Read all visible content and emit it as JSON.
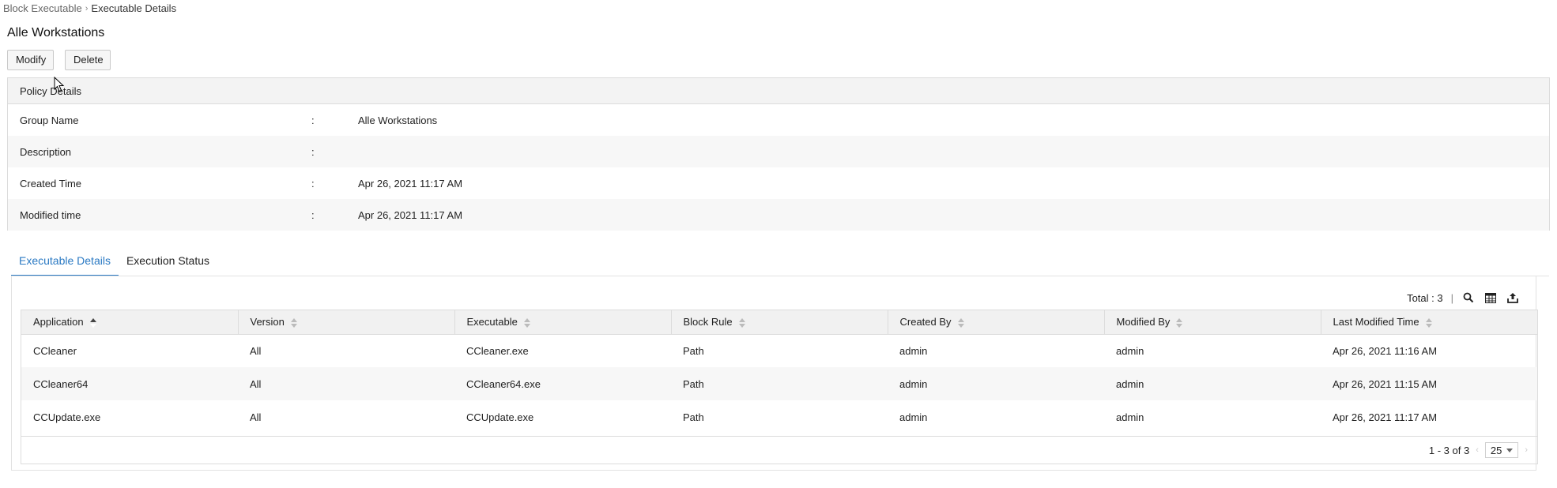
{
  "breadcrumb": {
    "parent": "Block Executable",
    "separator": "›",
    "current": "Executable Details"
  },
  "page": {
    "title": "Alle Workstations"
  },
  "actions": {
    "modify": "Modify",
    "delete": "Delete"
  },
  "policy": {
    "header": "Policy Details",
    "colon": ":",
    "rows": [
      {
        "label": "Group Name",
        "value": "Alle Workstations"
      },
      {
        "label": "Description",
        "value": ""
      },
      {
        "label": "Created Time",
        "value": "Apr 26, 2021 11:17 AM"
      },
      {
        "label": "Modified time",
        "value": "Apr 26, 2021 11:17 AM"
      }
    ]
  },
  "tabs": [
    {
      "label": "Executable Details",
      "active": true
    },
    {
      "label": "Execution Status",
      "active": false
    }
  ],
  "toolbar": {
    "total": "Total : 3",
    "divider": "|",
    "icons": [
      "search-icon",
      "columns-icon",
      "export-icon"
    ]
  },
  "table": {
    "columns": [
      "Application",
      "Version",
      "Executable",
      "Block Rule",
      "Created By",
      "Modified By",
      "Last Modified Time"
    ],
    "rows": [
      [
        "CCleaner",
        "All",
        "CCleaner.exe",
        "Path",
        "admin",
        "admin",
        "Apr 26, 2021 11:16 AM"
      ],
      [
        "CCleaner64",
        "All",
        "CCleaner64.exe",
        "Path",
        "admin",
        "admin",
        "Apr 26, 2021 11:15 AM"
      ],
      [
        "CCUpdate.exe",
        "All",
        "CCUpdate.exe",
        "Path",
        "admin",
        "admin",
        "Apr 26, 2021 11:17 AM"
      ]
    ],
    "sorted_column": "Application",
    "sort_direction": "ascending"
  },
  "pagination": {
    "range": "1 - 3 of 3",
    "prev": "‹",
    "next": "›",
    "page_size": "25"
  },
  "colors": {
    "accent": "#2a79c3",
    "header_bg": "#f3f3f3",
    "row_alt": "#f7f7f7"
  }
}
